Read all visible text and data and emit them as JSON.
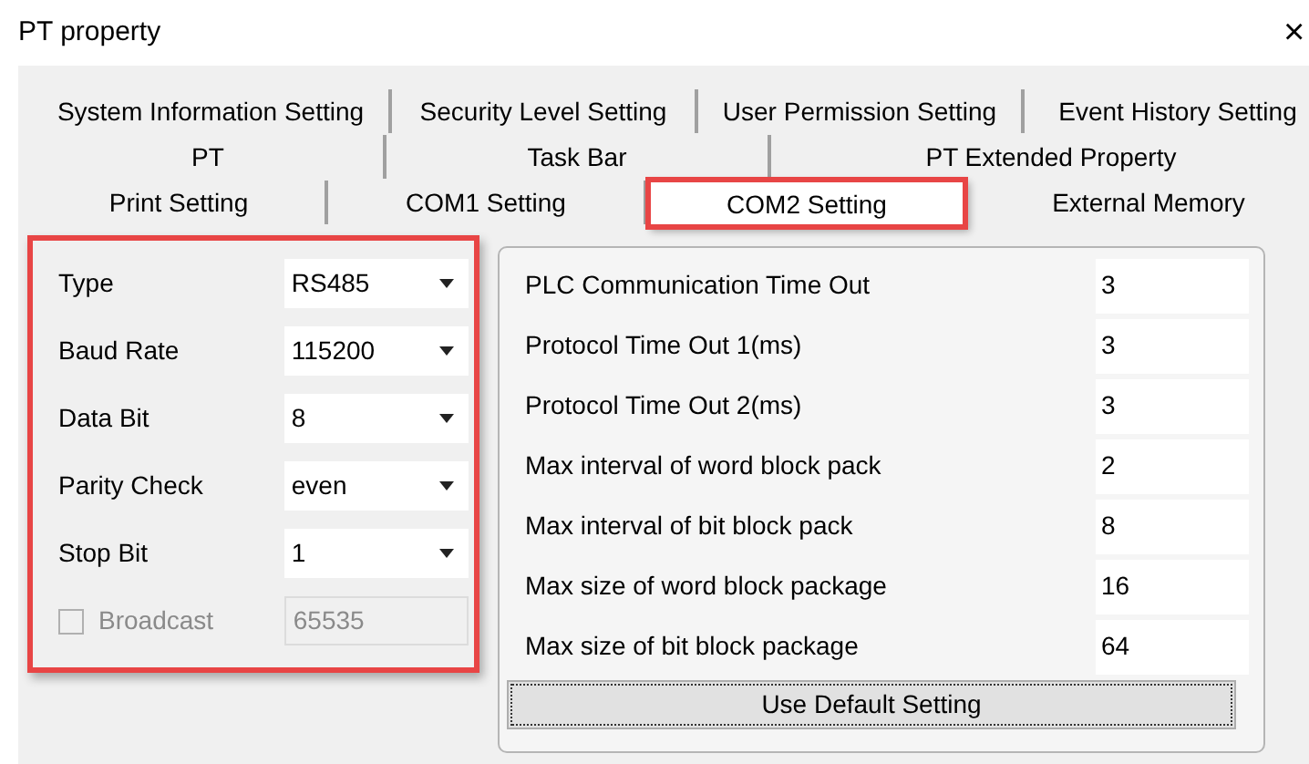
{
  "window": {
    "title": "PT property",
    "close": "×"
  },
  "tab_rows": [
    [
      {
        "label": "System Information Setting",
        "selected": false,
        "highlighted": false
      },
      {
        "label": "Security Level Setting",
        "selected": false,
        "highlighted": false
      },
      {
        "label": "User Permission Setting",
        "selected": false,
        "highlighted": false
      },
      {
        "label": "Event History Setting",
        "selected": false,
        "highlighted": false
      }
    ],
    [
      {
        "label": "PT",
        "selected": false,
        "highlighted": false
      },
      {
        "label": "Task Bar",
        "selected": false,
        "highlighted": false
      },
      {
        "label": "PT Extended Property",
        "selected": false,
        "highlighted": false
      }
    ],
    [
      {
        "label": "Print Setting",
        "selected": false,
        "highlighted": false
      },
      {
        "label": "COM1 Setting",
        "selected": false,
        "highlighted": false
      },
      {
        "label": "COM2 Setting",
        "selected": true,
        "highlighted": true
      },
      {
        "label": "External Memory",
        "selected": false,
        "highlighted": false
      }
    ]
  ],
  "port_settings": {
    "highlighted": true,
    "fields": [
      {
        "label": "Type",
        "value": "RS485"
      },
      {
        "label": "Baud Rate",
        "value": "115200"
      },
      {
        "label": "Data Bit",
        "value": "8"
      },
      {
        "label": "Parity Check",
        "value": "even"
      },
      {
        "label": "Stop Bit",
        "value": "1"
      }
    ],
    "broadcast": {
      "label": "Broadcast",
      "checked": false,
      "disabled": true,
      "value": "65535"
    }
  },
  "timing_settings": {
    "fields": [
      {
        "label": "PLC Communication Time Out",
        "value": "3"
      },
      {
        "label": "Protocol Time Out 1(ms)",
        "value": "3"
      },
      {
        "label": "Protocol Time Out 2(ms)",
        "value": "3"
      },
      {
        "label": "Max interval of word block pack",
        "value": "2"
      },
      {
        "label": "Max interval of bit block pack",
        "value": "8"
      },
      {
        "label": "Max size of word block package",
        "value": "16"
      },
      {
        "label": "Max size of bit block package",
        "value": "64"
      }
    ],
    "button": "Use Default Setting"
  }
}
